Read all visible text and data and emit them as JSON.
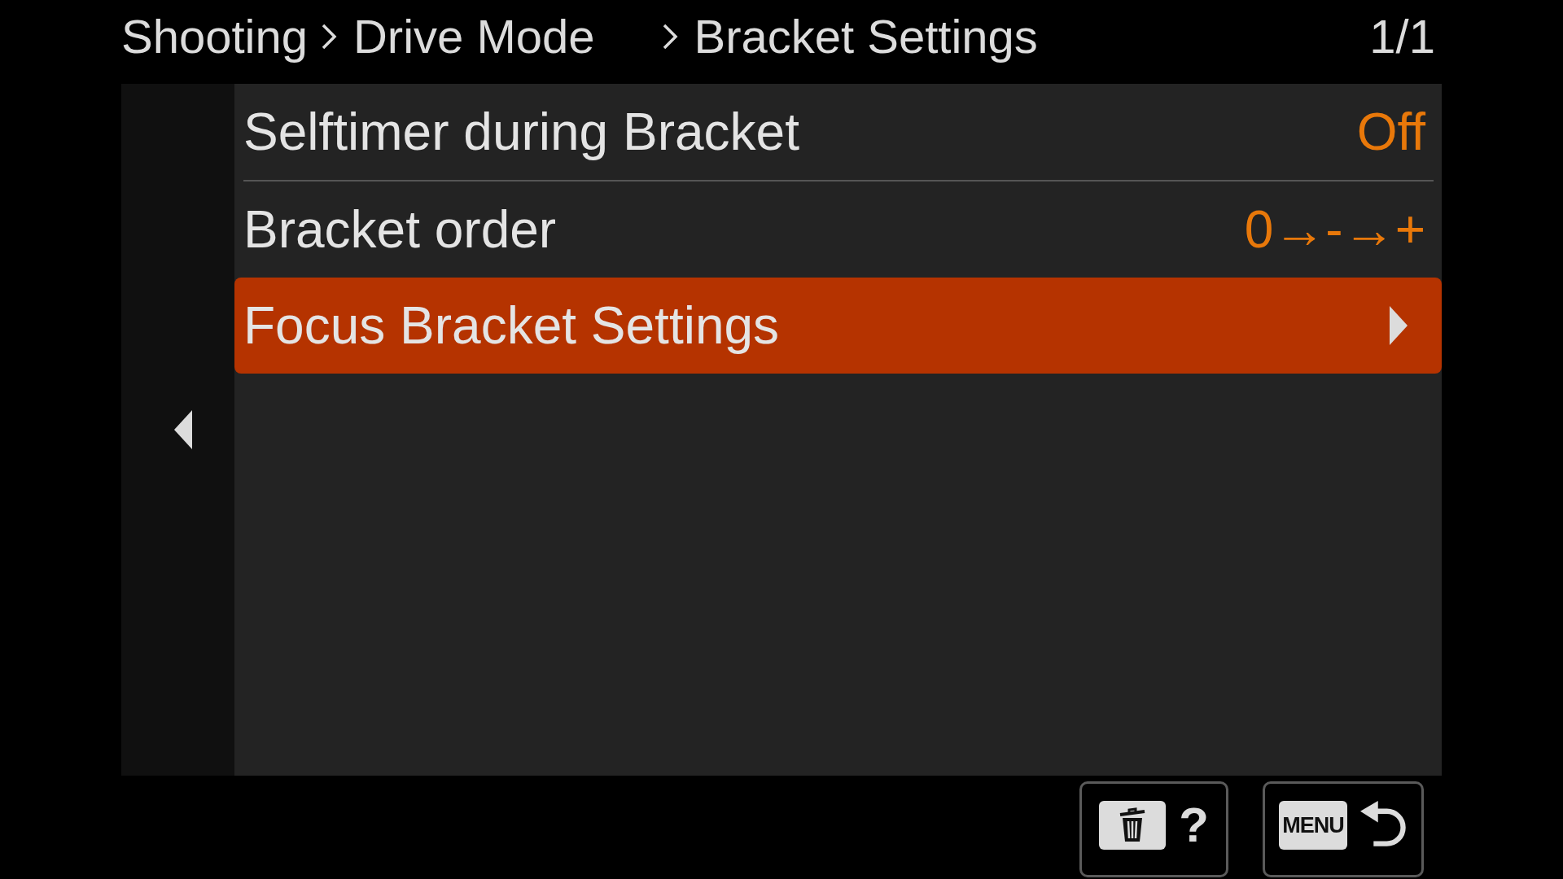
{
  "header": {
    "breadcrumbs": [
      "Shooting",
      "Drive Mode",
      "Bracket Settings"
    ],
    "page": "1/1"
  },
  "menu": {
    "rows": [
      {
        "kind": "value",
        "label": "Selftimer during Bracket",
        "value": "Off",
        "selected": false
      },
      {
        "kind": "value",
        "label": "Bracket order",
        "value": "0→-→+",
        "selected": false
      },
      {
        "kind": "submenu",
        "label": "Focus Bracket Settings",
        "selected": true
      }
    ]
  },
  "footer": {
    "buttons": [
      {
        "kind": "delete_help",
        "label": "?"
      },
      {
        "kind": "menu_back",
        "label": "MENU"
      }
    ]
  }
}
